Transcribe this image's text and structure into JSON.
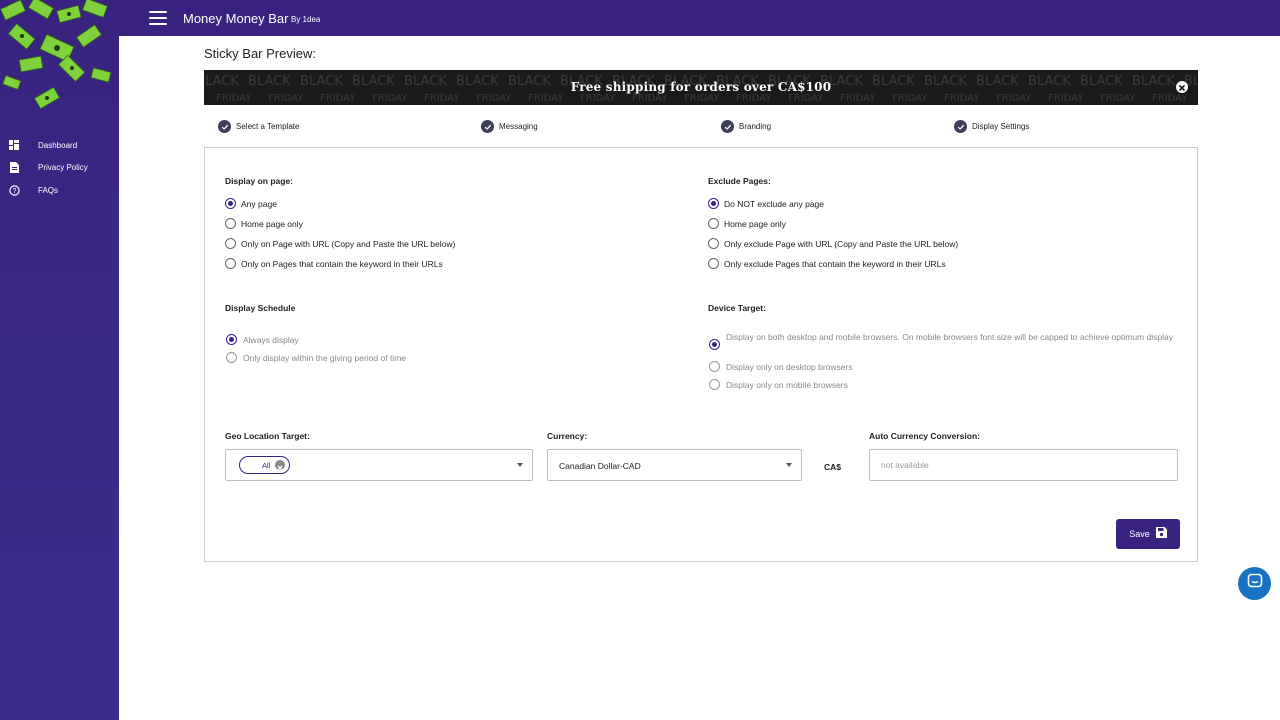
{
  "app": {
    "title": "Money Money Bar",
    "by": "By 1dea"
  },
  "sidebar": {
    "items": [
      {
        "label": "Dashboard",
        "icon": "dashboard-icon"
      },
      {
        "label": "Privacy Policy",
        "icon": "document-icon"
      },
      {
        "label": "FAQs",
        "icon": "help-icon"
      }
    ]
  },
  "preview": {
    "title": "Sticky Bar Preview:",
    "bar_text": "Free shipping for orders over CA$100",
    "background_words": [
      "BLACK",
      "FRIDAY"
    ]
  },
  "stepper": {
    "steps": [
      {
        "label": "Select a Template",
        "done": true
      },
      {
        "label": "Messaging",
        "done": true
      },
      {
        "label": "Branding",
        "done": true
      },
      {
        "label": "Display Settings",
        "done": true,
        "active": true
      }
    ]
  },
  "display_on_page": {
    "title": "Display on page:",
    "options": [
      {
        "label": "Any page",
        "checked": true
      },
      {
        "label": "Home page only",
        "checked": false
      },
      {
        "label": "Only on Page with URL (Copy and Paste the URL below)",
        "checked": false
      },
      {
        "label": "Only on Pages that contain the keyword in their URLs",
        "checked": false
      }
    ]
  },
  "exclude_pages": {
    "title": "Exclude Pages:",
    "options": [
      {
        "label": "Do NOT exclude any page",
        "checked": true
      },
      {
        "label": "Home page only",
        "checked": false
      },
      {
        "label": "Only exclude Page with URL (Copy and Paste the URL below)",
        "checked": false
      },
      {
        "label": "Only exclude Pages that contain the keyword in their URLs",
        "checked": false
      }
    ]
  },
  "display_schedule": {
    "title": "Display Schedule",
    "options": [
      {
        "label": "Always display",
        "checked": true
      },
      {
        "label": "Only display within the giving period of time",
        "checked": false
      }
    ]
  },
  "device_target": {
    "title": "Device Target:",
    "options": [
      {
        "label": "Display on both desktop and mobile browsers. On mobile browsers font size will be capped to achieve optimum display",
        "checked": true
      },
      {
        "label": "Display only on desktop browsers",
        "checked": false
      },
      {
        "label": "Display only on mobile browsers",
        "checked": false
      }
    ]
  },
  "geo": {
    "label": "Geo Location Target:",
    "chip": "All"
  },
  "currency": {
    "label": "Currency:",
    "value": "Canadian Dollar-CAD",
    "symbol": "CA$"
  },
  "auto_conversion": {
    "label": "Auto Currency Conversion:",
    "placeholder": "not available"
  },
  "actions": {
    "save_label": "Save"
  },
  "colors": {
    "brand": "#3a2380",
    "chat": "#1a73c2",
    "step_check": "#3d3f5a"
  }
}
